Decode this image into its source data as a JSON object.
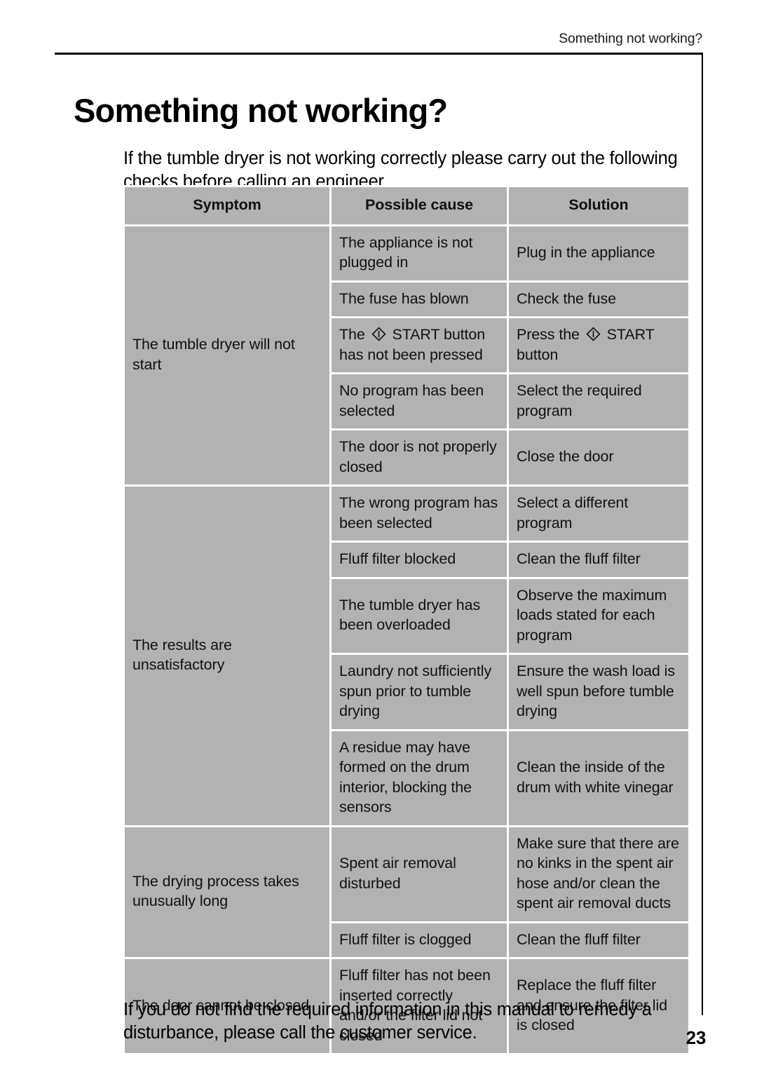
{
  "page": {
    "running_head": "Something not working?",
    "title": "Something not working?",
    "intro": "If the tumble dryer is not working correctly please carry out the following checks before calling an engineer.",
    "closing": "If you do not find the required information in this manual to remedy a disturbance, please call the customer service.",
    "page_number": "23"
  },
  "table": {
    "headers": {
      "symptom": "Symptom",
      "cause": "Possible cause",
      "solution": "Solution"
    },
    "groups": [
      {
        "symptom": "The tumble dryer will not start",
        "rows": [
          {
            "cause": "The appliance is not plugged in",
            "solution": "Plug in the appliance"
          },
          {
            "cause": "The fuse has blown",
            "solution": "Check the fuse"
          },
          {
            "cause_pre": "The",
            "cause_icon": "start-power-diamond-icon",
            "cause_post": "START button has not been pressed",
            "solution_pre": "Press the",
            "solution_icon": "start-power-diamond-icon",
            "solution_post": "START button"
          },
          {
            "cause": "No program has been selected",
            "solution": "Select the required program"
          },
          {
            "cause": "The door is not properly closed",
            "solution": "Close the door"
          }
        ]
      },
      {
        "symptom": "The results are unsatisfactory",
        "rows": [
          {
            "cause": "The wrong program has been selected",
            "solution": "Select a different program"
          },
          {
            "cause": "Fluff filter blocked",
            "solution": "Clean the fluff filter"
          },
          {
            "cause": "The tumble dryer has been overloaded",
            "solution": "Observe the maximum loads stated for each program"
          },
          {
            "cause": "Laundry not sufficiently spun prior to tumble drying",
            "solution": "Ensure the wash load is well spun before tumble drying"
          },
          {
            "cause": "A residue may have formed on the drum interior, blocking the sensors",
            "solution": "Clean the inside of the drum with white vinegar"
          }
        ]
      },
      {
        "symptom": "The drying process takes unusually long",
        "rows": [
          {
            "cause": "Spent air removal disturbed",
            "solution": "Make sure that there are no kinks in the spent air hose and/or clean the spent air removal ducts"
          },
          {
            "cause": "Fluff filter is clogged",
            "solution": "Clean the fluff filter"
          }
        ]
      },
      {
        "symptom": "The door cannot be closed",
        "rows": [
          {
            "cause": "Fluff filter has not been inserted correctly and/or the filter lid not closed",
            "solution": "Replace the fluff filter and ensure the filter lid is closed"
          }
        ]
      }
    ]
  },
  "colors": {
    "cell_background": "#b2b2b2",
    "grid_line": "#ffffff",
    "rule": "#000000",
    "text": "#111111"
  }
}
